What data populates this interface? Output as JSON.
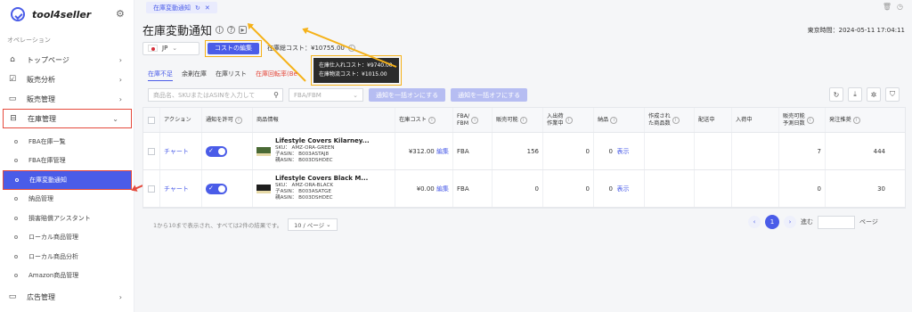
{
  "brand": {
    "name": "tool4seller"
  },
  "sidebar": {
    "section": "オペレーション",
    "top": [
      {
        "label": "トップページ",
        "icon": "home-icon"
      },
      {
        "label": "販売分析",
        "icon": "chart-icon"
      },
      {
        "label": "販売管理",
        "icon": "box-icon"
      },
      {
        "label": "在庫管理",
        "icon": "inventory-icon"
      }
    ],
    "sub": [
      {
        "label": "FBA在庫一覧"
      },
      {
        "label": "FBA在庫管理"
      },
      {
        "label": "在庫変動通知"
      },
      {
        "label": "納品管理"
      },
      {
        "label": "損害賠償アシスタント"
      },
      {
        "label": "ローカル商品管理"
      },
      {
        "label": "ローカル商品分析"
      },
      {
        "label": "Amazon商品管理"
      }
    ],
    "bottom": {
      "label": "広告管理",
      "icon": "monitor-icon"
    }
  },
  "tabstrip": {
    "tab_label": "在庫変動通知"
  },
  "page": {
    "title": "在庫変動通知",
    "clock": "東京時間：2024-05-11 17:04:11"
  },
  "controls": {
    "marketplace": "JP",
    "cost_edit_button": "コストの編集",
    "total_cost": "在庫総コスト：¥10755.00"
  },
  "tooltip": {
    "line1": "在庫仕入れコスト：¥9740.00",
    "line2": "在庫物流コスト：¥1015.00"
  },
  "subtabs": [
    "在庫不足",
    "余剰在庫",
    "在庫リスト",
    "在庫回転率(Be"
  ],
  "filters": {
    "search_placeholder": "商品名、SKUまたはASINを入力して",
    "fba_select": "FBA/FBM",
    "bulk_on": "通知を一括オンにする",
    "bulk_off": "通知を一括オフにする"
  },
  "table": {
    "headers": {
      "action": "アクション",
      "notify": "通知を許可",
      "product": "商品情報",
      "cost": "在庫コスト",
      "fba1": "FBA/",
      "fba2": "FBM",
      "sellable": "販売可能",
      "io1": "入出荷",
      "io2": "作業中",
      "inbound": "納品",
      "made1": "作成され",
      "made2": "た商品数",
      "shipping": "配送中",
      "receiving": "入荷中",
      "days1": "販売可能",
      "days2": "予測日数",
      "reorder": "発注推奨"
    },
    "rows": [
      {
        "action": "チャート",
        "name": "Lifestyle Covers Kilarney...",
        "sku": "SKU： AMZ-ORA-GREEN",
        "child_asin": "子ASIN： B003ASTAJ8",
        "parent_asin": "親ASIN： B003DSHDEC",
        "cost": "¥312.00",
        "edit": "編集",
        "fba": "FBA",
        "sellable": "156",
        "io": "0",
        "inbound": "0",
        "show": "表示",
        "days": "7",
        "reorder": "444"
      },
      {
        "action": "チャート",
        "name": "Lifestyle Covers Black M...",
        "sku": "SKU： AMZ-ORA-BLACK",
        "child_asin": "子ASIN： B003ASATGE",
        "parent_asin": "親ASIN： B003DSHDEC",
        "cost": "¥0.00",
        "edit": "編集",
        "fba": "FBA",
        "sellable": "0",
        "io": "0",
        "inbound": "0",
        "show": "表示",
        "days": "0",
        "reorder": "30"
      }
    ]
  },
  "footer": {
    "summary": "1から10まで表示され、すべては2件の結果です。",
    "page_size": "10 / ページ",
    "current_page": "1",
    "goto": "進む",
    "page_suffix": "ページ"
  }
}
